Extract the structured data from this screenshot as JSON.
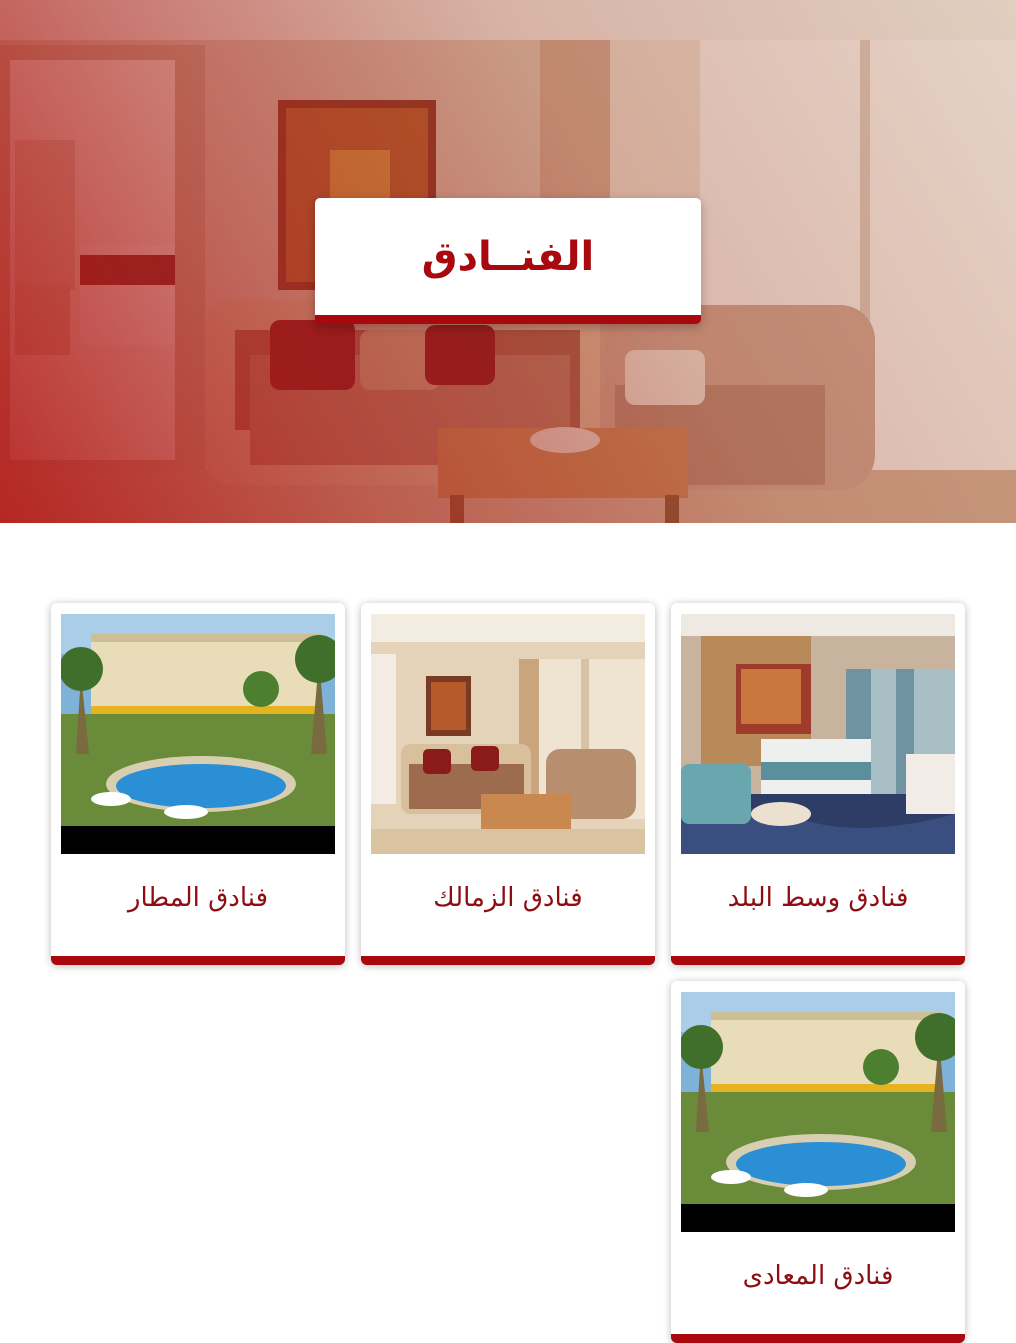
{
  "hero": {
    "title": "الفنــادق",
    "image": "hotel-suite-living-room-photo",
    "overlay_color": "#b21414"
  },
  "accent_color": "#a9080e",
  "cards": [
    {
      "title": "فنادق وسط البلد",
      "image": "hotel-bedroom-photo"
    },
    {
      "title": "فنادق الزمالك",
      "image": "hotel-suite-living-room-photo"
    },
    {
      "title": "فنادق المطار",
      "image": "hotel-pool-palm-trees-photo"
    },
    {
      "title": "فنادق المعادى",
      "image": "hotel-pool-palm-trees-photo"
    }
  ]
}
